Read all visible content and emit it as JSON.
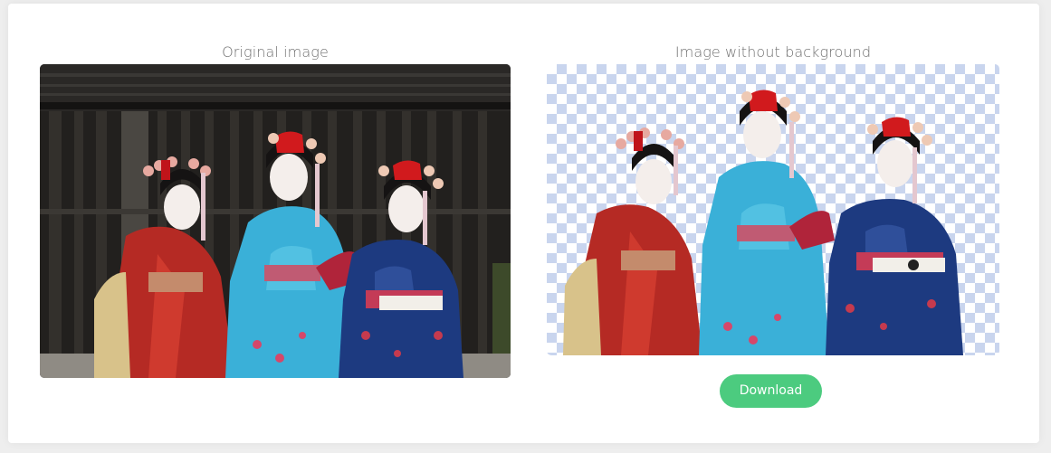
{
  "panels": {
    "original_label": "Original image",
    "nobg_label": "Image without background"
  },
  "actions": {
    "download_label": "Download"
  },
  "colors": {
    "download_button": "#4ccb7f",
    "checker": "#c9d5ee"
  },
  "images": {
    "original_alt": "photo-of-three-women-in-kimonos",
    "nobg_alt": "photo-with-background-removed"
  }
}
